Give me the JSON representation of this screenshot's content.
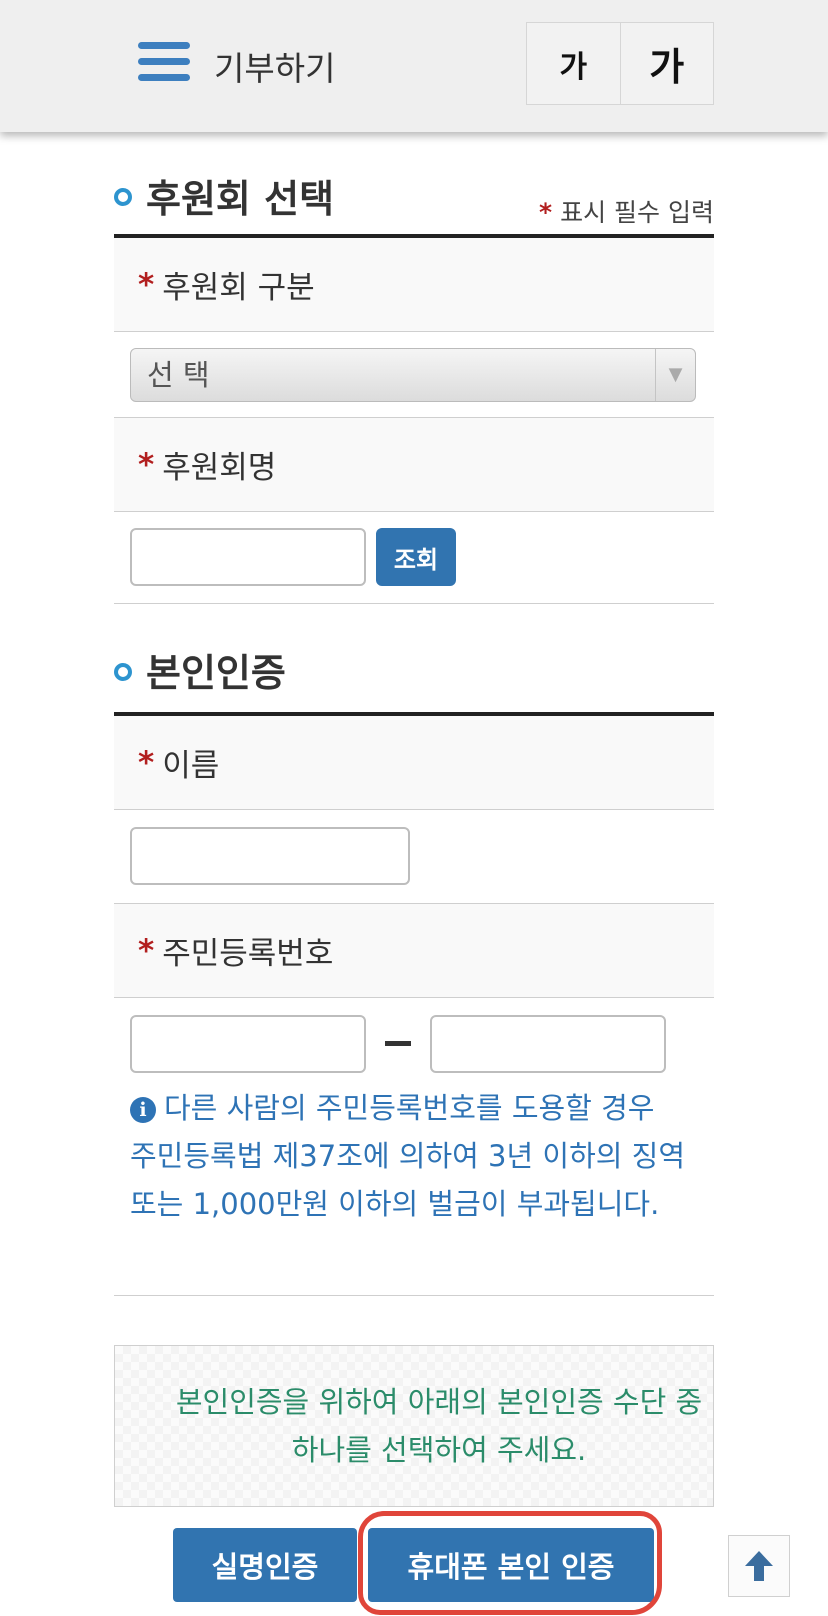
{
  "header": {
    "title": "기부하기",
    "font_small_label": "가",
    "font_large_label": "가"
  },
  "required_note": "표시 필수 입력",
  "required_star": "*",
  "sponsor_section": {
    "title": "후원회 선택",
    "type_label": "후원회 구분",
    "type_select_value": "선 택",
    "name_label": "후원회명",
    "search_button": "조회"
  },
  "auth_section": {
    "title": "본인인증",
    "name_label": "이름",
    "rrn_label": "주민등록번호",
    "rrn_separator": "-",
    "warning_icon": "i",
    "warning_text": "다른 사람의 주민등록번호를 도용할 경우 주민등록법 제37조에 의하여 3년 이하의 징역 또는 1,000만원 이하의 벌금이 부과됩니다."
  },
  "notice": "본인인증을 위하여 아래의 본인인증 수단 중 하나를 선택하여 주세요.",
  "buttons": {
    "real_name": "실명인증",
    "phone_auth": "휴대폰 본인 인증"
  },
  "colors": {
    "accent": "#3174b0",
    "required": "#b21f1f",
    "info": "#2e73b5",
    "notice": "#2b8c6a",
    "annotation": "#e0453a"
  },
  "icons": {
    "menu": "hamburger-icon",
    "info": "info-icon",
    "scroll_top": "arrow-up-icon"
  }
}
